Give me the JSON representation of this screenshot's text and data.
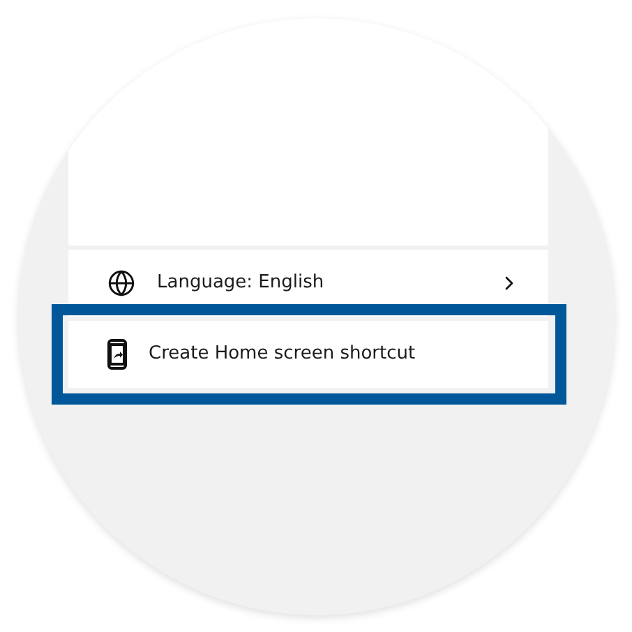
{
  "menu": {
    "items": [
      {
        "kind": "submenu",
        "label": "Language: English",
        "highlighted": false
      },
      {
        "kind": "action",
        "label": "Create Home screen shortcut",
        "highlighted": true
      }
    ]
  }
}
